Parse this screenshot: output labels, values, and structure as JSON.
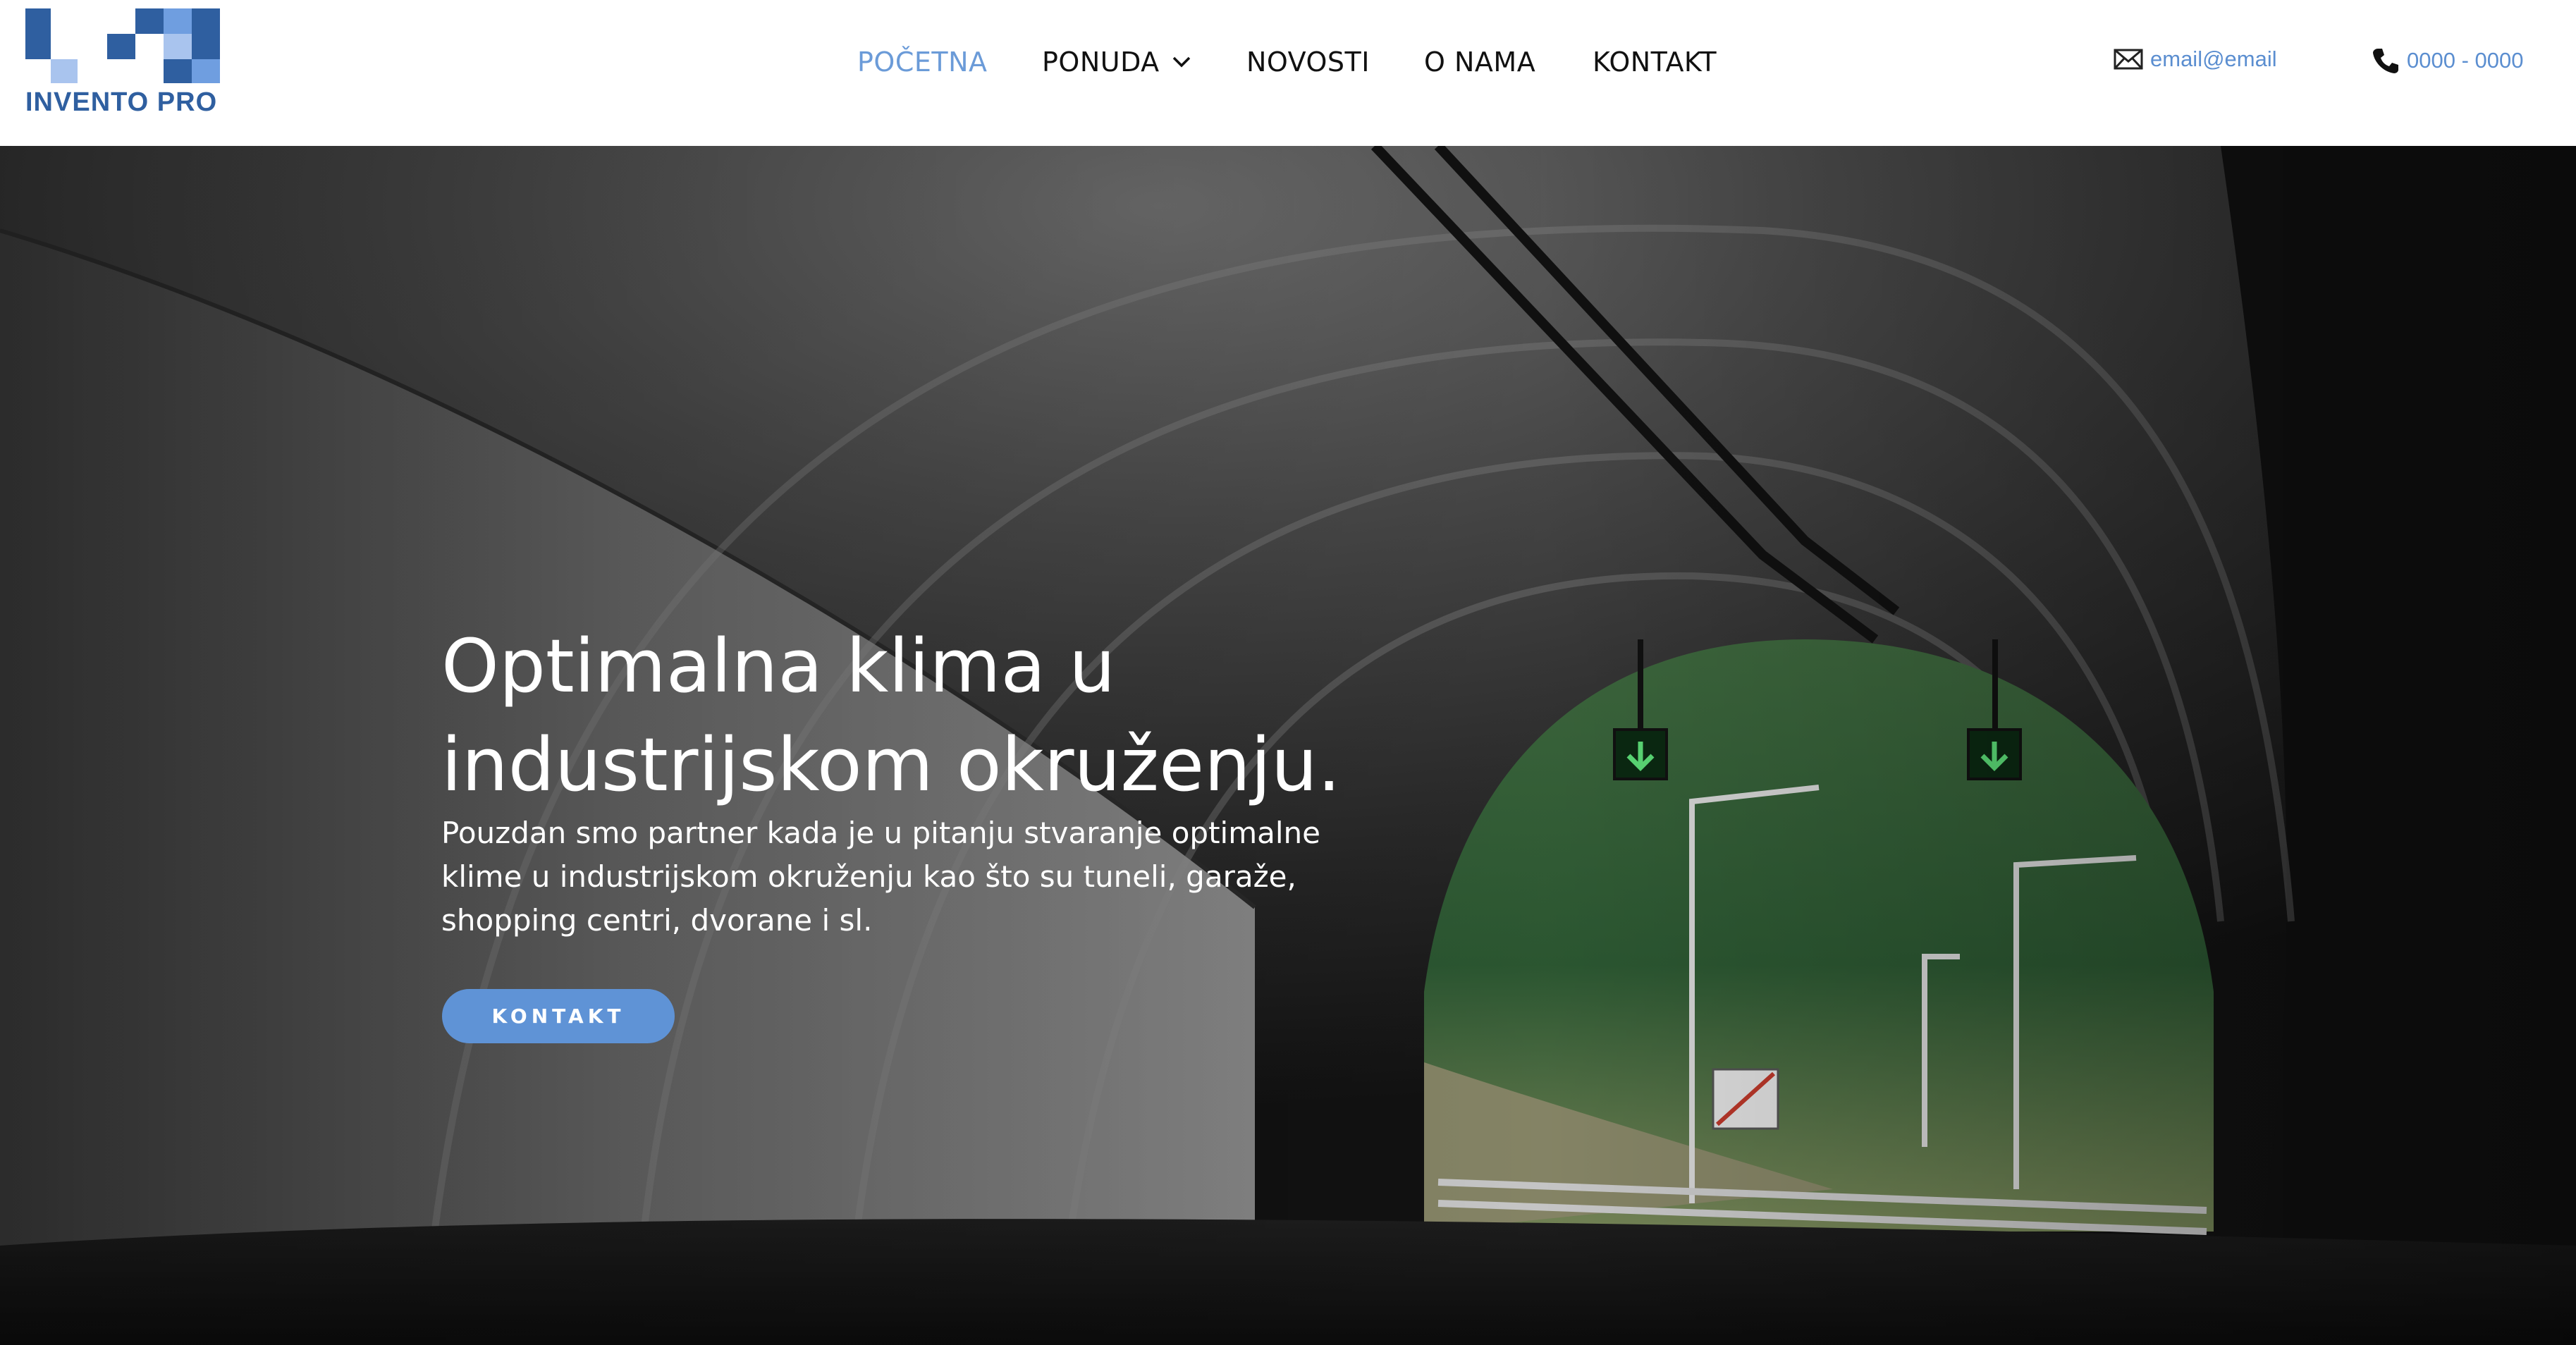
{
  "header": {
    "logo_text": "INVENTO PRO",
    "nav": [
      {
        "label": "POČETNA",
        "active": true
      },
      {
        "label": "PONUDA",
        "has_dropdown": true
      },
      {
        "label": "NOVOSTI"
      },
      {
        "label": "O NAMA"
      },
      {
        "label": "KONTAKT"
      }
    ],
    "email": {
      "icon": "envelope-icon",
      "text": "email@email"
    },
    "phone": {
      "icon": "phone-icon",
      "text": "0000 - 0000"
    }
  },
  "hero": {
    "title": "Optimalna klima u industrijskom okruženju.",
    "description": "Pouzdan smo partner kada je u pitanju stvaranje optimalne klime u industrijskom okruženju kao što su tuneli, garaže, shopping centri, dvorane i sl.",
    "button_label": "KONTAKT"
  },
  "colors": {
    "accent": "#6b9bd8",
    "button": "#5f93d6",
    "logo_dark": "#2f5fa0",
    "logo_mid": "#6f9ee0",
    "logo_light": "#a9c4ee"
  }
}
